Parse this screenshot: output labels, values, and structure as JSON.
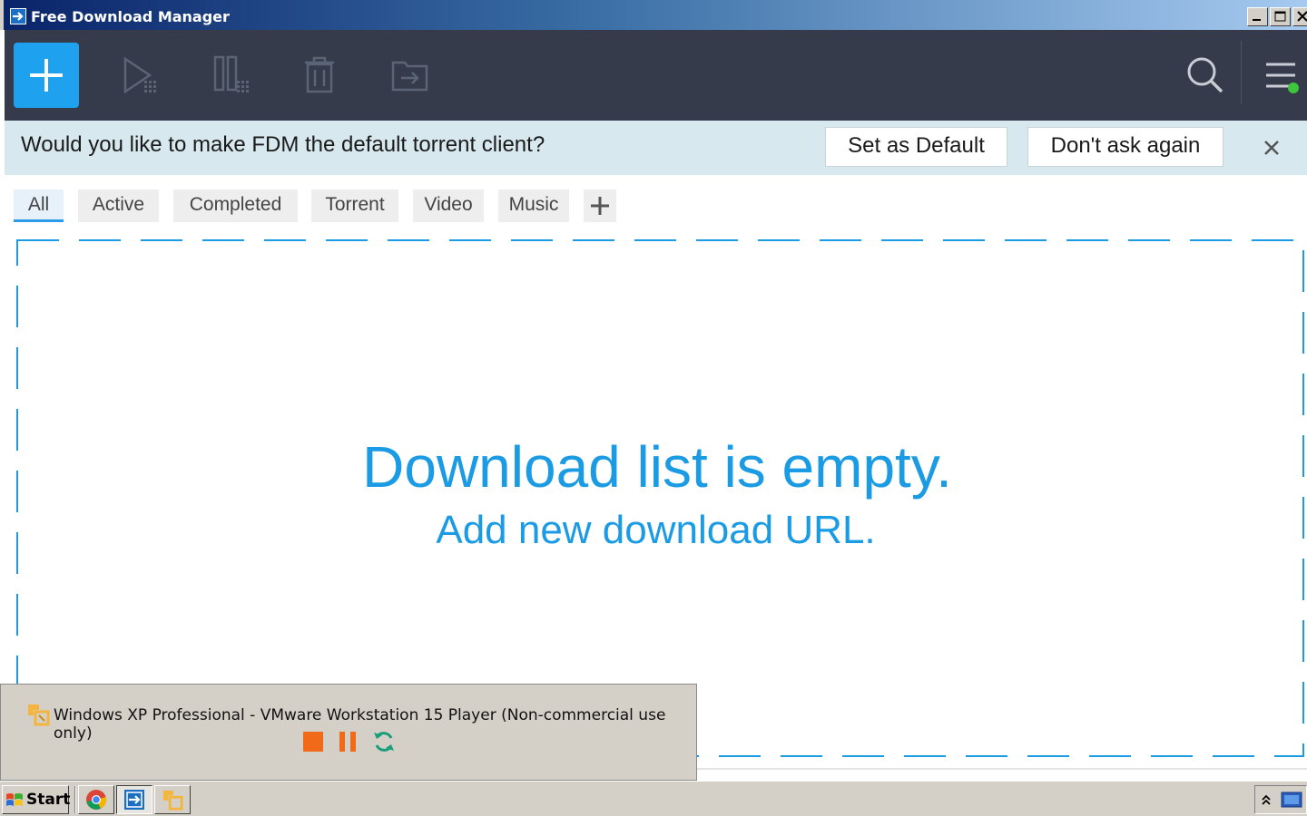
{
  "window": {
    "title": "Free Download Manager"
  },
  "notice": {
    "message": "Would you like to make FDM the default torrent client?",
    "set_default_label": "Set as Default",
    "dont_ask_label": "Don't ask again"
  },
  "tabs": [
    {
      "label": "All",
      "active": true
    },
    {
      "label": "Active",
      "active": false
    },
    {
      "label": "Completed",
      "active": false
    },
    {
      "label": "Torrent",
      "active": false
    },
    {
      "label": "Video",
      "active": false
    },
    {
      "label": "Music",
      "active": false
    }
  ],
  "empty_state": {
    "title": "Download list is empty.",
    "subtitle": "Add new download URL."
  },
  "vmware": {
    "title": "Windows XP Professional - VMware Workstation 15 Player (Non-commercial use only)"
  },
  "taskbar": {
    "start_label": "Start"
  },
  "colors": {
    "accent": "#1ea1ef",
    "toolbar_bg": "#353b4a",
    "notice_bg": "#d7e8ee",
    "empty_text": "#1a9be3",
    "status_dot": "#3dc53d",
    "stop": "#f06a1a",
    "pause": "#f06a1a",
    "restart": "#1a9e7a"
  }
}
